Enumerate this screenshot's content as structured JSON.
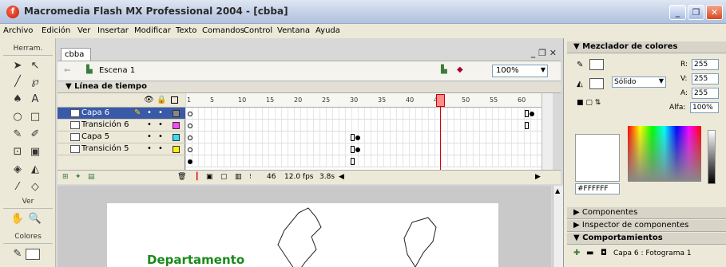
{
  "window": {
    "title": "Macromedia Flash MX Professional 2004 - [cbba]"
  },
  "menus": [
    "Archivo",
    "Edición",
    "Ver",
    "Insertar",
    "Modificar",
    "Texto",
    "Comandos",
    "Control",
    "Ventana",
    "Ayuda"
  ],
  "tools": {
    "header": "Herram.",
    "view_header": "Ver",
    "colors_header": "Colores"
  },
  "document": {
    "tab": "cbba",
    "scene": "Escena 1",
    "zoom": "100%"
  },
  "timeline": {
    "title": "Línea de tiempo",
    "ticks": [
      "1",
      "5",
      "10",
      "15",
      "20",
      "25",
      "30",
      "35",
      "40",
      "45",
      "50",
      "55",
      "60"
    ],
    "layers": [
      {
        "name": "Capa 6",
        "color": "#888888",
        "selected": true
      },
      {
        "name": "Transición 6",
        "color": "#ff44ff"
      },
      {
        "name": "Capa 5",
        "color": "#33ddff"
      },
      {
        "name": "Transición 5",
        "color": "#ffee00"
      }
    ],
    "current_frame": "46",
    "fps": "12.0 fps",
    "time": "3.8s"
  },
  "stage": {
    "text": "Departamento"
  },
  "panels": {
    "color_mixer": {
      "title": "Mezclador de colores",
      "fill_type": "Sólido",
      "r_label": "R:",
      "r": "255",
      "g_label": "V:",
      "g": "255",
      "b_label": "A:",
      "b": "255",
      "alpha_label": "Alfa:",
      "alpha": "100%",
      "hex": "#FFFFFF"
    },
    "components": "Componentes",
    "component_inspector": "Inspector de componentes",
    "behaviors": "Comportamientos",
    "behaviors_target": "Capa 6 : Fotograma 1"
  },
  "colors": {
    "accent": "#3a5aa8",
    "playhead": "#d00000",
    "stage_text": "#1a8a1a"
  }
}
